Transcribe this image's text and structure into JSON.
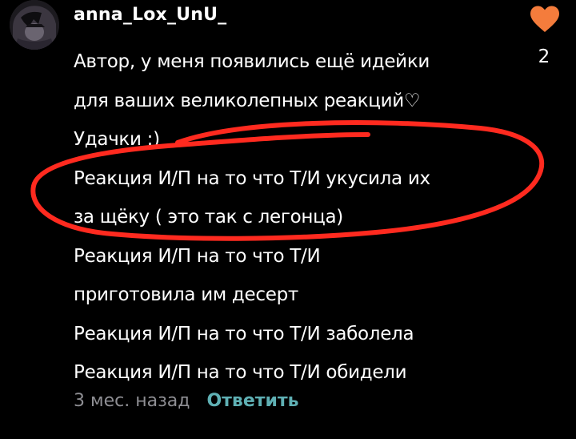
{
  "comment": {
    "username": "anna_Lox_UnU_",
    "like_count": "2",
    "lines": [
      "Автор, у меня появились ещё идейки",
      "для ваших великолепных реакций♡",
      "Удачки :)",
      "Реакция И/П на то что Т/И укусила их",
      "за щёку ( это так с легонца)",
      "Реакция И/П на то что Т/И",
      "приготовила им десерт",
      "Реакция И/П на то что Т/И заболела",
      "Реакция И/П на то что Т/И обидели"
    ],
    "timestamp": "3 мес. назад",
    "reply_label": "Ответить"
  },
  "icons": {
    "like": "heart-icon",
    "avatar": "avatar"
  },
  "colors": {
    "background": "#000000",
    "text": "#ffffff",
    "timestamp": "#8e8e93",
    "reply": "#5fb0b4",
    "heart": "#f47c3c",
    "annotation": "#ff2a1f"
  }
}
